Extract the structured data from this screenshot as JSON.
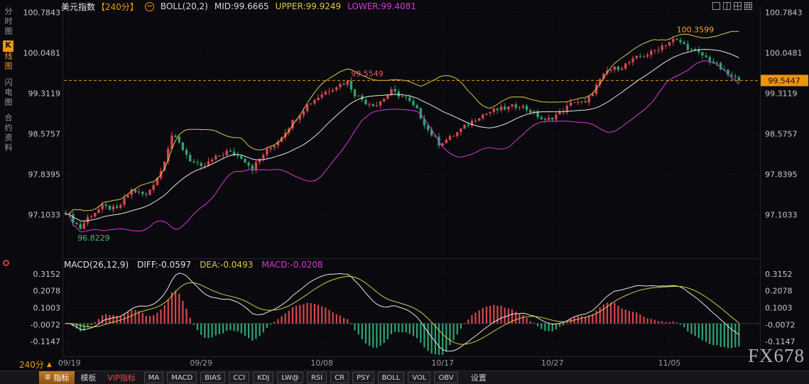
{
  "sidebar": {
    "items": [
      {
        "label": "分时图",
        "active": false
      },
      {
        "badge": "K",
        "rest": "线图",
        "active": true
      },
      {
        "label": "闪电图",
        "active": false
      },
      {
        "label": "合约资料",
        "active": false
      }
    ]
  },
  "topbar": {
    "symbol": "美元指数",
    "period": "【240分】",
    "indicator_label": "BOLL(20,2)",
    "mid": "MID:99.6665",
    "upper": "UPPER:99.9249",
    "lower": "LOWER:99.4081",
    "window_icons": [
      "layout-one-icon",
      "layout-two-icon",
      "layout-four-icon",
      "layout-nine-icon"
    ]
  },
  "macd_header": {
    "label": "MACD(26,12,9)",
    "diff": "DIFF:-0.0597",
    "dea": "DEA:-0.0493",
    "macd": "MACD:-0.0208"
  },
  "footer": {
    "period_label": "240分",
    "arrow": "▲",
    "tabs": [
      {
        "label": "指标"
      },
      {
        "label": "模板"
      },
      {
        "label": "VIP指标"
      }
    ],
    "indicators": [
      "MA",
      "MACD",
      "BIAS",
      "CCI",
      "KDJ",
      "LW@",
      "RSI",
      "CR",
      "PSY",
      "BOLL",
      "VOL",
      "OBV"
    ],
    "settings": "设置"
  },
  "watermark": "FX678",
  "chart_data": {
    "type": "candlestick",
    "symbol": "美元指数",
    "period": "240分",
    "overlays": [
      "BOLL(20,2)"
    ],
    "lower_pane": "MACD(26,12,9)",
    "bars": 185,
    "price_axis": {
      "ticks": [
        100.7843,
        100.0481,
        99.3119,
        98.5757,
        97.8395,
        97.1033
      ],
      "ylim": [
        96.4,
        100.88
      ]
    },
    "macd_axis": {
      "ticks": [
        0.3152,
        0.2078,
        0.1003,
        -0.0072,
        -0.1147
      ],
      "ylim": [
        -0.2,
        0.36
      ]
    },
    "x_ticks": [
      {
        "label": "09/19",
        "bar": 1
      },
      {
        "label": "09/29",
        "bar": 37
      },
      {
        "label": "10/08",
        "bar": 70
      },
      {
        "label": "10/17",
        "bar": 103
      },
      {
        "label": "10/27",
        "bar": 133
      },
      {
        "label": "11/05",
        "bar": 165
      }
    ],
    "close_anchors": [
      [
        0,
        97.15
      ],
      [
        2,
        97.0
      ],
      [
        4,
        96.86
      ],
      [
        6,
        97.05
      ],
      [
        10,
        97.25
      ],
      [
        14,
        97.2
      ],
      [
        18,
        97.55
      ],
      [
        22,
        97.45
      ],
      [
        26,
        97.9
      ],
      [
        29,
        98.55
      ],
      [
        31,
        98.4
      ],
      [
        34,
        98.1
      ],
      [
        37,
        97.95
      ],
      [
        40,
        98.1
      ],
      [
        44,
        98.25
      ],
      [
        48,
        98.15
      ],
      [
        51,
        97.95
      ],
      [
        54,
        98.2
      ],
      [
        58,
        98.45
      ],
      [
        62,
        98.8
      ],
      [
        66,
        99.1
      ],
      [
        70,
        99.3
      ],
      [
        74,
        99.45
      ],
      [
        77,
        99.52
      ],
      [
        79,
        99.3
      ],
      [
        82,
        99.15
      ],
      [
        85,
        99.1
      ],
      [
        89,
        99.35
      ],
      [
        93,
        99.22
      ],
      [
        96,
        99.0
      ],
      [
        99,
        98.65
      ],
      [
        102,
        98.4
      ],
      [
        105,
        98.5
      ],
      [
        109,
        98.7
      ],
      [
        113,
        98.9
      ],
      [
        117,
        99.0
      ],
      [
        121,
        99.05
      ],
      [
        124,
        99.1
      ],
      [
        128,
        98.95
      ],
      [
        131,
        98.8
      ],
      [
        133,
        98.88
      ],
      [
        136,
        99.0
      ],
      [
        139,
        99.18
      ],
      [
        142,
        99.12
      ],
      [
        145,
        99.45
      ],
      [
        148,
        99.72
      ],
      [
        152,
        99.8
      ],
      [
        156,
        99.95
      ],
      [
        160,
        100.05
      ],
      [
        163,
        100.18
      ],
      [
        166,
        100.28
      ],
      [
        168,
        100.24
      ],
      [
        171,
        100.1
      ],
      [
        174,
        100.0
      ],
      [
        177,
        99.88
      ],
      [
        180,
        99.7
      ],
      [
        182,
        99.6
      ],
      [
        184,
        99.5447
      ]
    ],
    "boll": {
      "period": 20,
      "k": 2
    },
    "macd": {
      "fast": 12,
      "slow": 26,
      "signal": 9
    },
    "annotations": [
      {
        "bar": 4,
        "price": 96.8229,
        "label": "96.8229",
        "color": "#45b97c",
        "kind": "low"
      },
      {
        "bar": 77,
        "price": 99.5549,
        "label": "99.5549",
        "color": "#e25d5d",
        "kind": "high"
      },
      {
        "bar": 166,
        "price": 100.3599,
        "label": "100.3599",
        "color": "#f0a43c",
        "kind": "high"
      }
    ],
    "last_price": "99.5447",
    "colors": {
      "up": "#d9454f",
      "down": "#2fa371",
      "boll_mid": "#e6e6e6",
      "boll_upper": "#d6c84f",
      "boll_lower": "#d63ad6",
      "diff": "#e6e6e6",
      "dea": "#d6c84f",
      "grid": "#1d1d26",
      "axis_text": "#c6c6cc",
      "date_text": "#9a9aa0",
      "last_line": "#ef9410"
    }
  }
}
